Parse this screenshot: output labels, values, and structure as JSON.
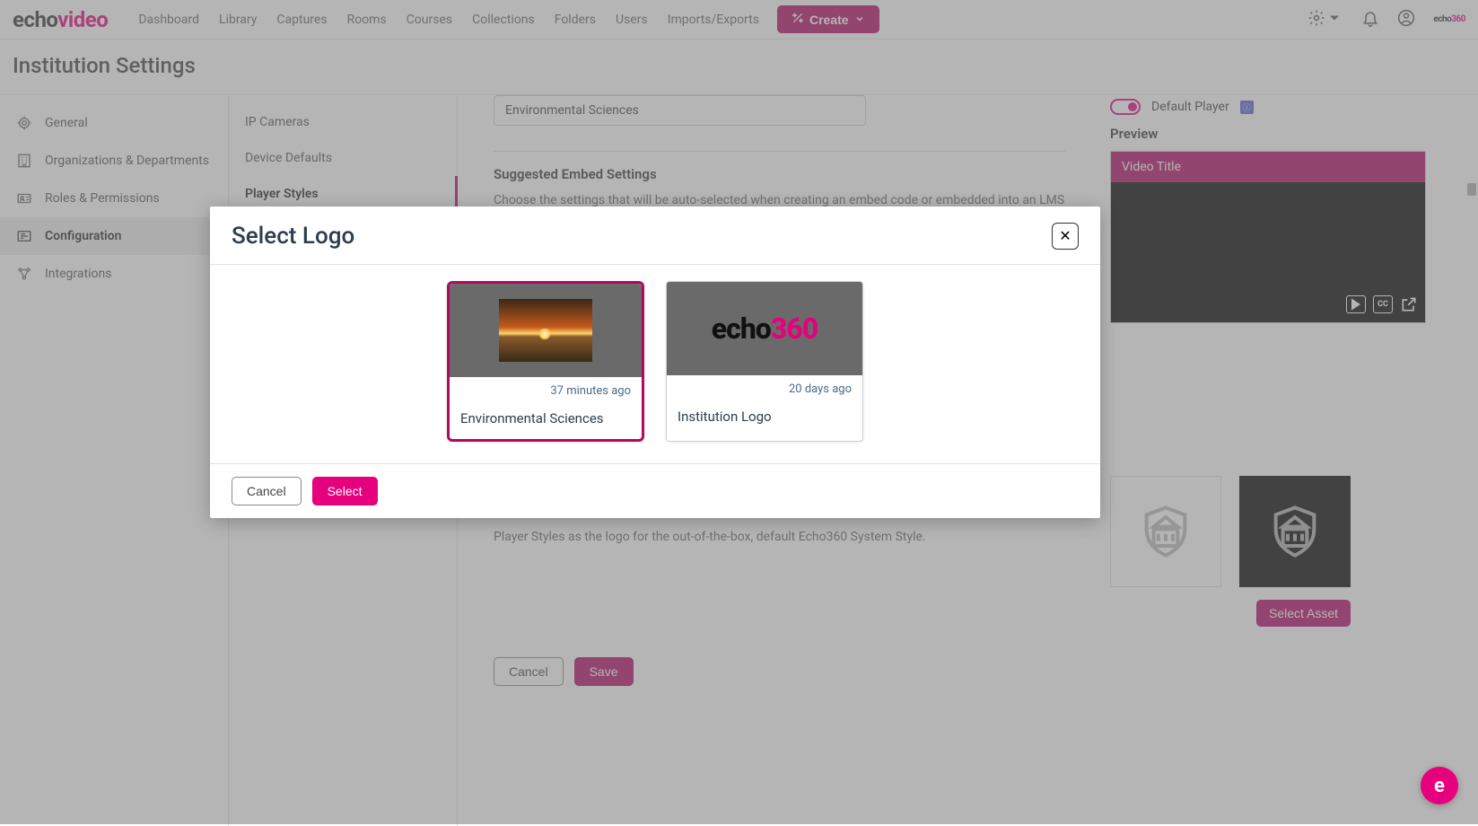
{
  "brand": {
    "part1": "echo",
    "part2": "video"
  },
  "nav": {
    "dashboard": "Dashboard",
    "library": "Library",
    "captures": "Captures",
    "rooms": "Rooms",
    "courses": "Courses",
    "collections": "Collections",
    "folders": "Folders",
    "users": "Users",
    "importsExports": "Imports/Exports"
  },
  "createBtn": "Create",
  "miniBrand": {
    "part1": "echo",
    "part2": "360"
  },
  "pageTitle": "Institution Settings",
  "sidebar": {
    "general": "General",
    "orgs": "Organizations & Departments",
    "roles": "Roles & Permissions",
    "configuration": "Configuration",
    "integrations": "Integrations"
  },
  "subnav": {
    "ipCameras": "IP Cameras",
    "deviceDefaults": "Device Defaults",
    "playerStyles": "Player Styles"
  },
  "content": {
    "styleName": "Environmental Sciences",
    "suggestedTitle": "Suggested Embed Settings",
    "suggestedHelp": "Choose the settings that will be auto-selected when creating an embed code or embedded into an LMS via the Easy Embed.",
    "defaultPlayer": "Default Player",
    "previewLabel": "Preview",
    "videoTitle": "Video Title",
    "logoHelp": "Player Styles as the logo for the out-of-the-box, default Echo360 System Style.",
    "selectAsset": "Select Asset",
    "cc": "CC",
    "cancel": "Cancel",
    "save": "Save"
  },
  "modal": {
    "title": "Select Logo",
    "cancel": "Cancel",
    "select": "Select",
    "assets": [
      {
        "time": "37 minutes ago",
        "title": "Environmental Sciences"
      },
      {
        "time": "20 days ago",
        "title": "Institution Logo"
      }
    ]
  },
  "fab": "e"
}
